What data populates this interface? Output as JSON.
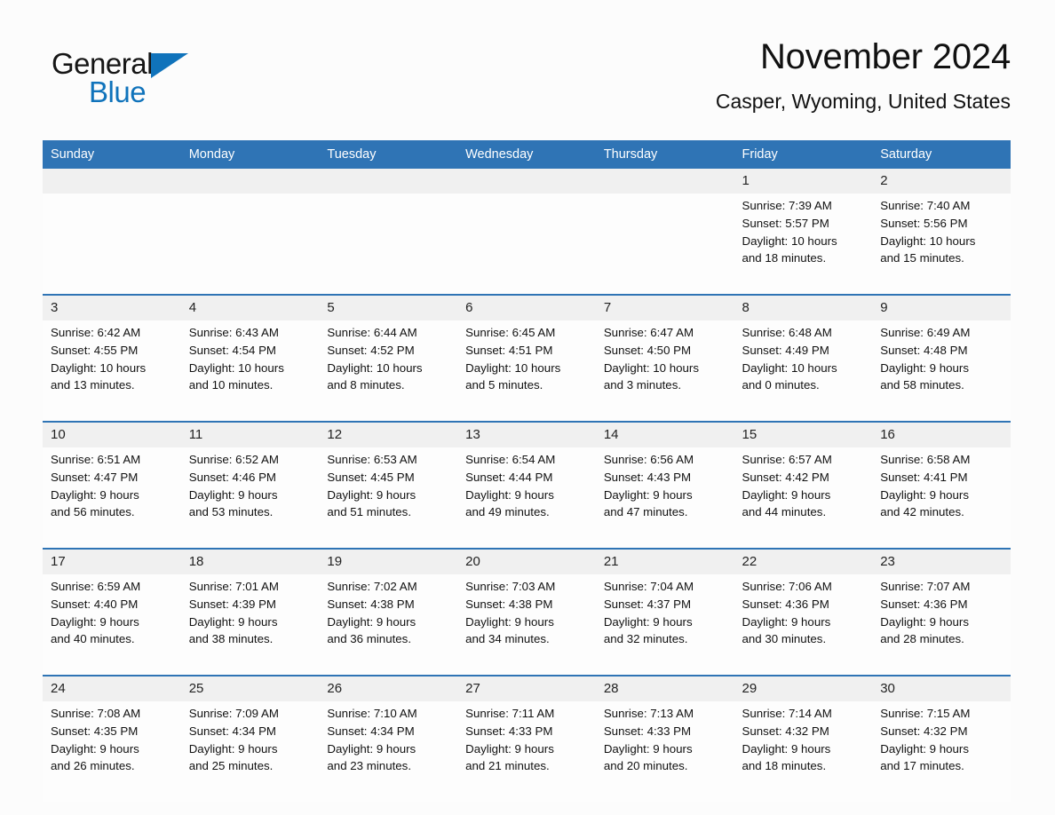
{
  "brand": {
    "word1": "General",
    "word2": "Blue",
    "triangle_color": "#1073bb"
  },
  "header": {
    "title": "November 2024",
    "subtitle": "Casper, Wyoming, United States"
  },
  "theme": {
    "header_blue": "#2f74b5",
    "daynum_band": "#f0f0f0",
    "page_background": "#fcfcfc",
    "text": "#111111"
  },
  "weekday_headers": [
    "Sunday",
    "Monday",
    "Tuesday",
    "Wednesday",
    "Thursday",
    "Friday",
    "Saturday"
  ],
  "weeks": [
    {
      "days": [
        {
          "number": "",
          "lines": []
        },
        {
          "number": "",
          "lines": []
        },
        {
          "number": "",
          "lines": []
        },
        {
          "number": "",
          "lines": []
        },
        {
          "number": "",
          "lines": []
        },
        {
          "number": "1",
          "sunrise": "Sunrise: 7:39 AM",
          "sunset": "Sunset: 5:57 PM",
          "daylight1": "Daylight: 10 hours",
          "daylight2": "and 18 minutes."
        },
        {
          "number": "2",
          "sunrise": "Sunrise: 7:40 AM",
          "sunset": "Sunset: 5:56 PM",
          "daylight1": "Daylight: 10 hours",
          "daylight2": "and 15 minutes."
        }
      ]
    },
    {
      "days": [
        {
          "number": "3",
          "sunrise": "Sunrise: 6:42 AM",
          "sunset": "Sunset: 4:55 PM",
          "daylight1": "Daylight: 10 hours",
          "daylight2": "and 13 minutes."
        },
        {
          "number": "4",
          "sunrise": "Sunrise: 6:43 AM",
          "sunset": "Sunset: 4:54 PM",
          "daylight1": "Daylight: 10 hours",
          "daylight2": "and 10 minutes."
        },
        {
          "number": "5",
          "sunrise": "Sunrise: 6:44 AM",
          "sunset": "Sunset: 4:52 PM",
          "daylight1": "Daylight: 10 hours",
          "daylight2": "and 8 minutes."
        },
        {
          "number": "6",
          "sunrise": "Sunrise: 6:45 AM",
          "sunset": "Sunset: 4:51 PM",
          "daylight1": "Daylight: 10 hours",
          "daylight2": "and 5 minutes."
        },
        {
          "number": "7",
          "sunrise": "Sunrise: 6:47 AM",
          "sunset": "Sunset: 4:50 PM",
          "daylight1": "Daylight: 10 hours",
          "daylight2": "and 3 minutes."
        },
        {
          "number": "8",
          "sunrise": "Sunrise: 6:48 AM",
          "sunset": "Sunset: 4:49 PM",
          "daylight1": "Daylight: 10 hours",
          "daylight2": "and 0 minutes."
        },
        {
          "number": "9",
          "sunrise": "Sunrise: 6:49 AM",
          "sunset": "Sunset: 4:48 PM",
          "daylight1": "Daylight: 9 hours",
          "daylight2": "and 58 minutes."
        }
      ]
    },
    {
      "days": [
        {
          "number": "10",
          "sunrise": "Sunrise: 6:51 AM",
          "sunset": "Sunset: 4:47 PM",
          "daylight1": "Daylight: 9 hours",
          "daylight2": "and 56 minutes."
        },
        {
          "number": "11",
          "sunrise": "Sunrise: 6:52 AM",
          "sunset": "Sunset: 4:46 PM",
          "daylight1": "Daylight: 9 hours",
          "daylight2": "and 53 minutes."
        },
        {
          "number": "12",
          "sunrise": "Sunrise: 6:53 AM",
          "sunset": "Sunset: 4:45 PM",
          "daylight1": "Daylight: 9 hours",
          "daylight2": "and 51 minutes."
        },
        {
          "number": "13",
          "sunrise": "Sunrise: 6:54 AM",
          "sunset": "Sunset: 4:44 PM",
          "daylight1": "Daylight: 9 hours",
          "daylight2": "and 49 minutes."
        },
        {
          "number": "14",
          "sunrise": "Sunrise: 6:56 AM",
          "sunset": "Sunset: 4:43 PM",
          "daylight1": "Daylight: 9 hours",
          "daylight2": "and 47 minutes."
        },
        {
          "number": "15",
          "sunrise": "Sunrise: 6:57 AM",
          "sunset": "Sunset: 4:42 PM",
          "daylight1": "Daylight: 9 hours",
          "daylight2": "and 44 minutes."
        },
        {
          "number": "16",
          "sunrise": "Sunrise: 6:58 AM",
          "sunset": "Sunset: 4:41 PM",
          "daylight1": "Daylight: 9 hours",
          "daylight2": "and 42 minutes."
        }
      ]
    },
    {
      "days": [
        {
          "number": "17",
          "sunrise": "Sunrise: 6:59 AM",
          "sunset": "Sunset: 4:40 PM",
          "daylight1": "Daylight: 9 hours",
          "daylight2": "and 40 minutes."
        },
        {
          "number": "18",
          "sunrise": "Sunrise: 7:01 AM",
          "sunset": "Sunset: 4:39 PM",
          "daylight1": "Daylight: 9 hours",
          "daylight2": "and 38 minutes."
        },
        {
          "number": "19",
          "sunrise": "Sunrise: 7:02 AM",
          "sunset": "Sunset: 4:38 PM",
          "daylight1": "Daylight: 9 hours",
          "daylight2": "and 36 minutes."
        },
        {
          "number": "20",
          "sunrise": "Sunrise: 7:03 AM",
          "sunset": "Sunset: 4:38 PM",
          "daylight1": "Daylight: 9 hours",
          "daylight2": "and 34 minutes."
        },
        {
          "number": "21",
          "sunrise": "Sunrise: 7:04 AM",
          "sunset": "Sunset: 4:37 PM",
          "daylight1": "Daylight: 9 hours",
          "daylight2": "and 32 minutes."
        },
        {
          "number": "22",
          "sunrise": "Sunrise: 7:06 AM",
          "sunset": "Sunset: 4:36 PM",
          "daylight1": "Daylight: 9 hours",
          "daylight2": "and 30 minutes."
        },
        {
          "number": "23",
          "sunrise": "Sunrise: 7:07 AM",
          "sunset": "Sunset: 4:36 PM",
          "daylight1": "Daylight: 9 hours",
          "daylight2": "and 28 minutes."
        }
      ]
    },
    {
      "days": [
        {
          "number": "24",
          "sunrise": "Sunrise: 7:08 AM",
          "sunset": "Sunset: 4:35 PM",
          "daylight1": "Daylight: 9 hours",
          "daylight2": "and 26 minutes."
        },
        {
          "number": "25",
          "sunrise": "Sunrise: 7:09 AM",
          "sunset": "Sunset: 4:34 PM",
          "daylight1": "Daylight: 9 hours",
          "daylight2": "and 25 minutes."
        },
        {
          "number": "26",
          "sunrise": "Sunrise: 7:10 AM",
          "sunset": "Sunset: 4:34 PM",
          "daylight1": "Daylight: 9 hours",
          "daylight2": "and 23 minutes."
        },
        {
          "number": "27",
          "sunrise": "Sunrise: 7:11 AM",
          "sunset": "Sunset: 4:33 PM",
          "daylight1": "Daylight: 9 hours",
          "daylight2": "and 21 minutes."
        },
        {
          "number": "28",
          "sunrise": "Sunrise: 7:13 AM",
          "sunset": "Sunset: 4:33 PM",
          "daylight1": "Daylight: 9 hours",
          "daylight2": "and 20 minutes."
        },
        {
          "number": "29",
          "sunrise": "Sunrise: 7:14 AM",
          "sunset": "Sunset: 4:32 PM",
          "daylight1": "Daylight: 9 hours",
          "daylight2": "and 18 minutes."
        },
        {
          "number": "30",
          "sunrise": "Sunrise: 7:15 AM",
          "sunset": "Sunset: 4:32 PM",
          "daylight1": "Daylight: 9 hours",
          "daylight2": "and 17 minutes."
        }
      ]
    }
  ]
}
